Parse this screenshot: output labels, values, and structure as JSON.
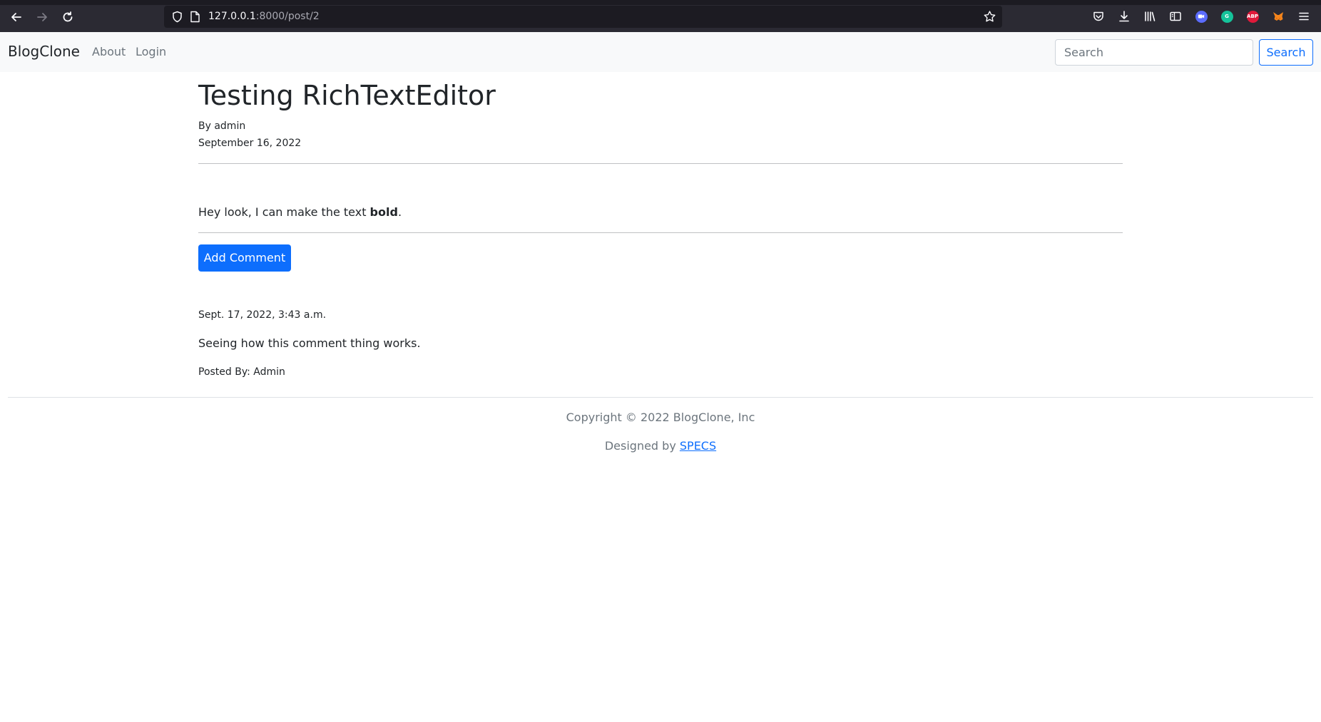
{
  "browser": {
    "url_host": "127.0.0.1",
    "url_path": ":8000/post/2",
    "icons": [
      "back-icon",
      "forward-icon",
      "reload-icon",
      "shield-icon",
      "page-icon",
      "bookmark-star-icon",
      "pocket-icon",
      "download-icon",
      "library-icon",
      "sidebar-icon",
      "zoom-extension-icon",
      "grammarly-icon",
      "adblock-icon",
      "metamask-icon",
      "menu-icon"
    ],
    "extension_labels": {
      "adblock": "ABP"
    }
  },
  "navbar": {
    "brand": "BlogClone",
    "links": [
      "About",
      "Login"
    ],
    "search_placeholder": "Search",
    "search_button": "Search"
  },
  "post": {
    "title": "Testing RichTextEditor",
    "author_line": "By admin",
    "date": "September 16, 2022",
    "body_prefix": "Hey look, I can make the text ",
    "body_bold": "bold",
    "body_suffix": "."
  },
  "actions": {
    "add_comment": "Add Comment"
  },
  "comments": [
    {
      "date": "Sept. 17, 2022, 3:43 a.m.",
      "text": "Seeing how this comment thing works.",
      "author": "Posted By: Admin"
    }
  ],
  "footer": {
    "copyright": "Copyright © 2022 BlogClone, Inc",
    "designed_prefix": "Designed by ",
    "designed_link": "SPECS"
  },
  "colors": {
    "primary": "#0d6efd",
    "navbar_bg": "#f8f9fa",
    "muted": "#6c757d",
    "chrome_bg": "#2b2a33"
  }
}
